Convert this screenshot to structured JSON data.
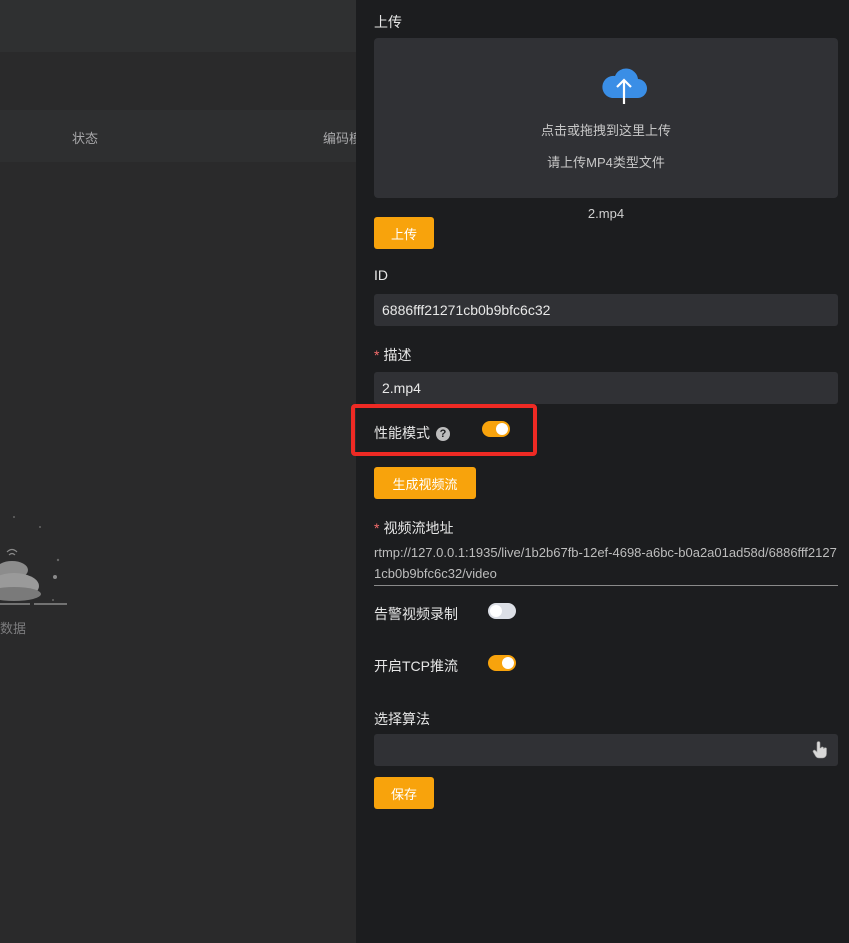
{
  "background": {
    "table": {
      "columns": [
        "状态",
        "编码模"
      ]
    },
    "empty_text": "数据"
  },
  "drawer": {
    "upload": {
      "label": "上传",
      "hint": "点击或拖拽到这里上传",
      "tip": "请上传MP4类型文件",
      "file_name": "2.mp4",
      "button": "上传",
      "icon": "cloud-upload-icon"
    },
    "id": {
      "label": "ID",
      "value": "6886fff21271cb0b9bfc6c32"
    },
    "description": {
      "required": "*",
      "label": "描述",
      "value": "2.mp4"
    },
    "performance_mode": {
      "label": "性能模式",
      "help": "?",
      "enabled": true
    },
    "generate_button": "生成视频流",
    "stream_url": {
      "required": "*",
      "label": "视频流地址",
      "value": "rtmp://127.0.0.1:1935/live/1b2b67fb-12ef-4698-a6bc-b0a2a01ad58d/6886fff21271cb0b9bfc6c32/video"
    },
    "alarm_recording": {
      "label": "告警视频录制",
      "enabled": false
    },
    "tcp_push": {
      "label": "开启TCP推流",
      "enabled": true
    },
    "algorithm": {
      "label": "选择算法",
      "value": ""
    },
    "save_button": "保存"
  },
  "colors": {
    "accent": "#f8a30c",
    "highlight": "#ee2a24",
    "upload_icon": "#3a8ee6",
    "drawer_bg": "#1c1d1f",
    "input_bg": "#303135"
  }
}
